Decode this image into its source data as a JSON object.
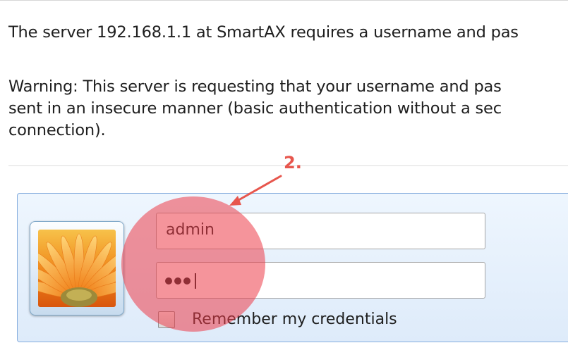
{
  "dialog": {
    "server_message": "The server 192.168.1.1 at SmartAX requires a username and pas",
    "warning_lines": [
      "Warning: This server is requesting that your username and pas",
      "sent in an insecure manner (basic authentication without a sec",
      "connection)."
    ]
  },
  "credentials": {
    "username_value": "admin",
    "password_mask": "•••",
    "remember_label": "Remember my credentials",
    "remember_checked": false
  },
  "annotation": {
    "step_label": "2.",
    "color": "#e7564d"
  },
  "icons": {
    "user_tile": "flower-user-icon",
    "arrow": "annotation-arrow-icon"
  },
  "colors": {
    "panel_border": "#84acdd",
    "panel_background": "#e6f0fc",
    "highlight": "#ec3c48"
  }
}
